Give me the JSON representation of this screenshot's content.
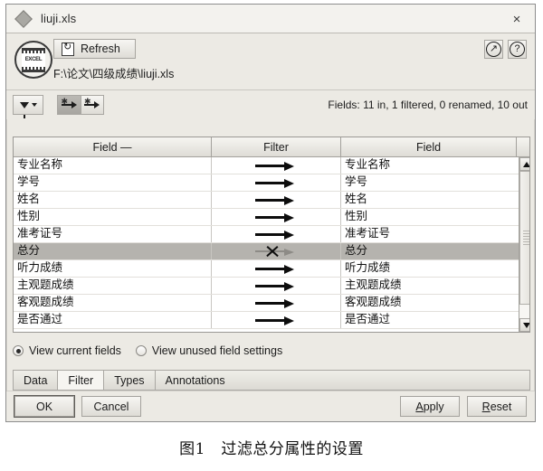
{
  "window": {
    "title": "liuji.xls",
    "title_icon": "diamond-icon",
    "close_label": "×"
  },
  "source": {
    "refresh_label": "Refresh",
    "refresh_icon": "refresh-icon",
    "app_icon": "excel-icon",
    "app_icon_text": "EXCEL",
    "file_path": "F:\\论文\\四级成绩\\liuji.xls",
    "expand_icon": "expand-arrow-icon",
    "help_icon": "help-question-icon"
  },
  "toolbar": {
    "funnel_icon": "filter-funnel-icon",
    "caret_icon": "chevron-down-icon",
    "keep_icon": "arrow-keep-icon",
    "drop_icon": "arrow-drop-icon",
    "fields_status": "Fields: 11 in, 1 filtered, 0 renamed, 10 out"
  },
  "table": {
    "headers": [
      "Field —",
      "Filter",
      "Field"
    ],
    "rows": [
      {
        "field_in": "专业名称",
        "filter": "pass",
        "field_out": "专业名称",
        "selected": false
      },
      {
        "field_in": "学号",
        "filter": "pass",
        "field_out": "学号",
        "selected": false
      },
      {
        "field_in": "姓名",
        "filter": "pass",
        "field_out": "姓名",
        "selected": false
      },
      {
        "field_in": "性别",
        "filter": "pass",
        "field_out": "性别",
        "selected": false
      },
      {
        "field_in": "准考证号",
        "filter": "pass",
        "field_out": "准考证号",
        "selected": false
      },
      {
        "field_in": "总分",
        "filter": "blocked",
        "field_out": "总分",
        "selected": true
      },
      {
        "field_in": "听力成绩",
        "filter": "pass",
        "field_out": "听力成绩",
        "selected": false
      },
      {
        "field_in": "主观题成绩",
        "filter": "pass",
        "field_out": "主观题成绩",
        "selected": false
      },
      {
        "field_in": "客观题成绩",
        "filter": "pass",
        "field_out": "客观题成绩",
        "selected": false
      },
      {
        "field_in": "是否通过",
        "filter": "pass",
        "field_out": "是否通过",
        "selected": false
      }
    ]
  },
  "view_options": [
    {
      "label": "View current fields",
      "selected": true
    },
    {
      "label": "View unused field settings",
      "selected": false
    }
  ],
  "tabs": [
    {
      "label": "Data",
      "active": false
    },
    {
      "label": "Filter",
      "active": true
    },
    {
      "label": "Types",
      "active": false
    },
    {
      "label": "Annotations",
      "active": false
    }
  ],
  "buttons": {
    "ok": "OK",
    "cancel": "Cancel",
    "apply_mnemonic": "A",
    "apply_rest": "pply",
    "reset_mnemonic": "R",
    "reset_rest": "eset"
  },
  "caption": "图1　过滤总分属性的设置",
  "colors": {
    "dialog_bg": "#eceae4",
    "title_bg": "#f3f2ee",
    "selection": "#b5b3ae",
    "text": "#1c1c1c"
  }
}
